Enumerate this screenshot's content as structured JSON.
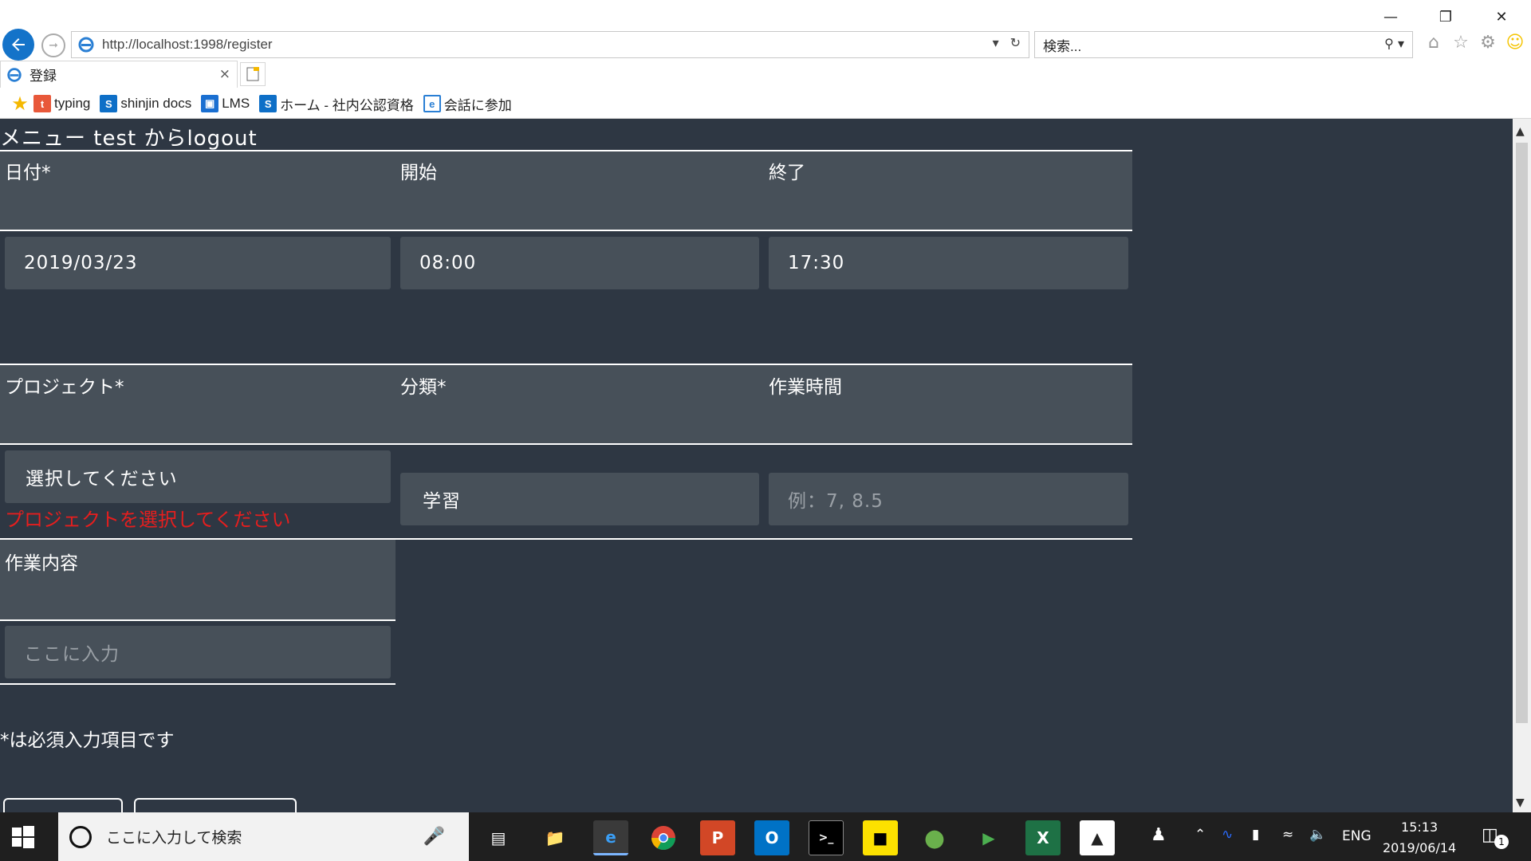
{
  "window": {
    "minimize_icon": "minimize-icon",
    "restore_icon": "restore-icon",
    "close_icon": "close-icon"
  },
  "address": {
    "url": "http://localhost:1998/register"
  },
  "search": {
    "placeholder": "検索..."
  },
  "tab": {
    "title": "登録",
    "close": "×"
  },
  "favorites": [
    {
      "label": "typing",
      "icon": "typing-icon",
      "color": "#e8583a"
    },
    {
      "label": "shinjin docs",
      "icon": "sharepoint-icon",
      "color": "#0e6fc7"
    },
    {
      "label": "LMS",
      "icon": "monitor-icon",
      "color": "#1a6fd1"
    },
    {
      "label": "ホーム - 社内公認資格",
      "icon": "sharepoint-icon",
      "color": "#0e6fc7"
    },
    {
      "label": "会話に参加",
      "icon": "ie-icon",
      "color": "#2a7fd4"
    }
  ],
  "page": {
    "menu_label": "メニュー",
    "logout_label": "test からlogout",
    "labels": {
      "date": "日付*",
      "start": "開始",
      "end": "終了",
      "project": "プロジェクト*",
      "category": "分類*",
      "work_hours": "作業時間",
      "work_content": "作業内容"
    },
    "fields": {
      "date": "2019/03/23",
      "start": "08:00",
      "end": "17:30",
      "project": "選択してください",
      "category": "学習",
      "work_hours_placeholder": "例：7, 8.5",
      "work_content_placeholder": "ここに入力"
    },
    "error": "プロジェクトを選択してください",
    "note": "*は必須入力項目です"
  },
  "taskbar": {
    "search_placeholder": "ここに入力して検索",
    "lang": "ENG",
    "time": "15:13",
    "date": "2019/06/14",
    "notification_count": "1"
  }
}
